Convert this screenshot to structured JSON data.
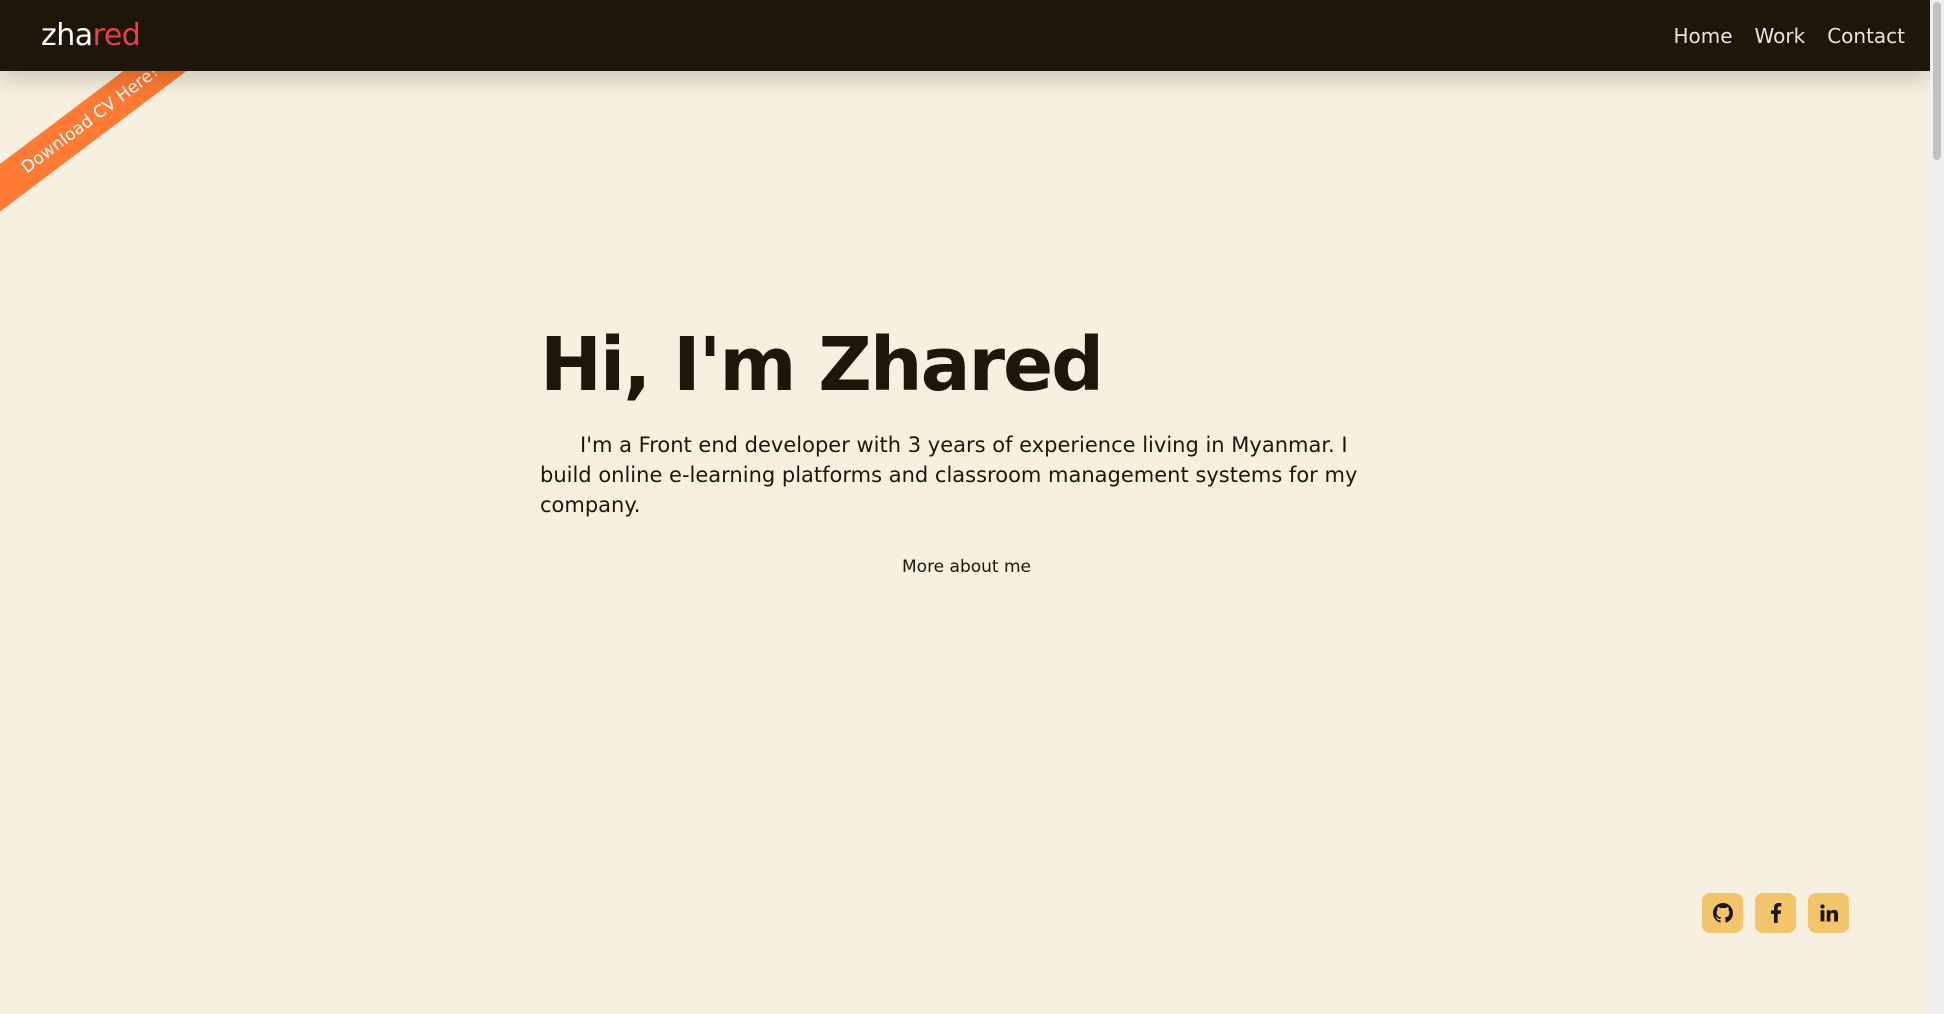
{
  "brand": {
    "part1": "zha",
    "part2": "red"
  },
  "nav": {
    "items": [
      "Home",
      "Work",
      "Contact"
    ]
  },
  "ribbon": {
    "label": "Download CV Here!"
  },
  "hero": {
    "title": "Hi, I'm Zhared",
    "description": "I'm a Front end developer with 3 years of experience living in Myanmar. I build online e-learning platforms and classroom management systems for my company.",
    "more_label": "More about me"
  },
  "social": {
    "icons": [
      "github-icon",
      "facebook-icon",
      "linkedin-icon"
    ]
  },
  "colors": {
    "background": "#f7f0e0",
    "navbar": "#1d1609",
    "accent_red": "#e8404a",
    "ribbon": "#ff7a33",
    "social_bg": "#f2c46b"
  }
}
